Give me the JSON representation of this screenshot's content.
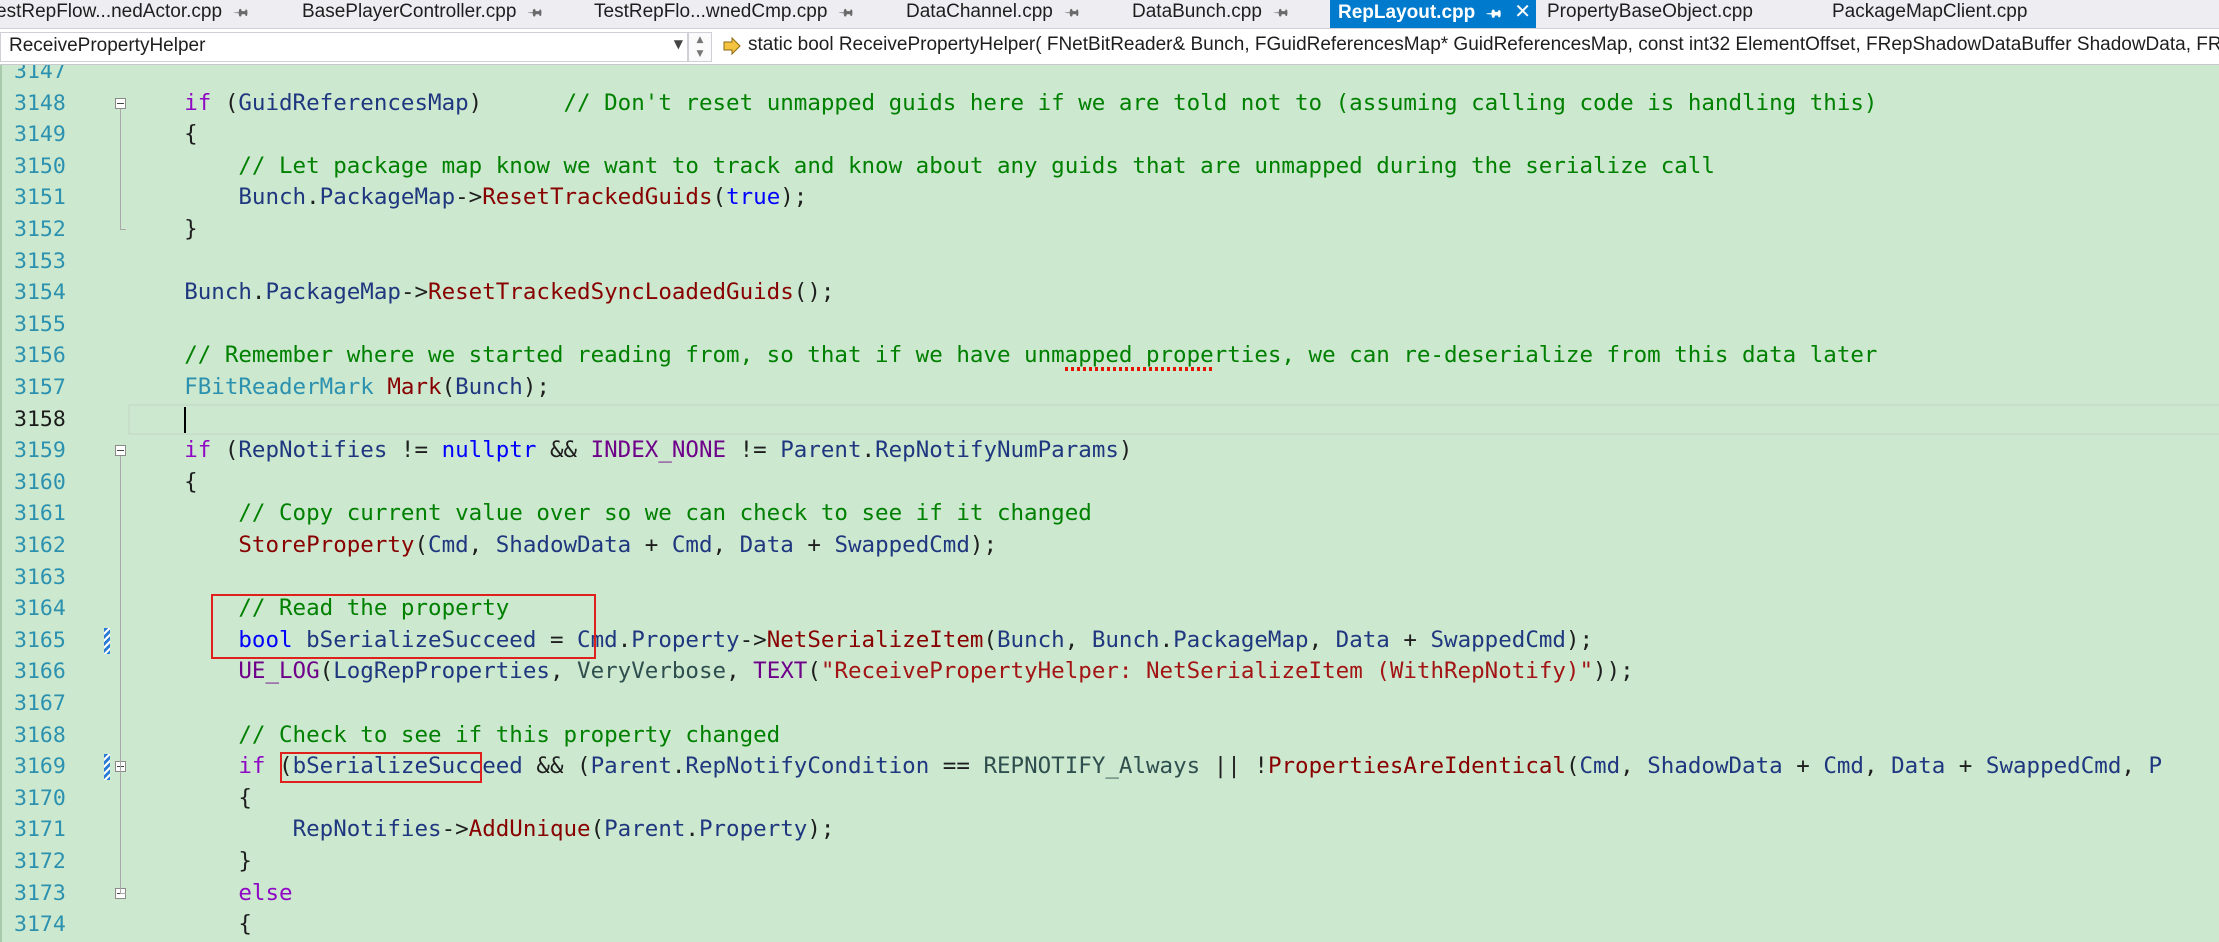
{
  "tabs": [
    {
      "label": "estRepFlow...nedActor.cpp",
      "active": false
    },
    {
      "label": "BasePlayerController.cpp",
      "active": false
    },
    {
      "label": "TestRepFlo...wnedCmp.cpp",
      "active": false
    },
    {
      "label": "DataChannel.cpp",
      "active": false
    },
    {
      "label": "DataBunch.cpp",
      "active": false
    },
    {
      "label": "RepLayout.cpp",
      "active": true
    },
    {
      "label": "PropertyBaseObject.cpp",
      "active": false
    },
    {
      "label": "PackageMapClient.cpp",
      "active": false
    }
  ],
  "navbar": {
    "scope": "ReceivePropertyHelper",
    "member": "static bool ReceivePropertyHelper( FNetBitReader& Bunch, FGuidReferencesMap* GuidReferencesMap, const int32 ElementOffset, FRepShadowDataBuffer ShadowData, FR"
  },
  "editor": {
    "current_line": "3158",
    "lines": [
      {
        "num": "3147",
        "tokens": [
          {
            "t": "        ",
            "c": "op"
          }
        ]
      },
      {
        "num": "3148",
        "tokens": [
          {
            "t": "    ",
            "c": "op"
          },
          {
            "t": "if",
            "c": "kw2"
          },
          {
            "t": " (",
            "c": "op"
          },
          {
            "t": "GuidReferencesMap",
            "c": "var"
          },
          {
            "t": ")      ",
            "c": "op"
          },
          {
            "t": "// Don't reset unmapped guids here if we are told not to (assuming calling code is handling this)",
            "c": "cm"
          }
        ]
      },
      {
        "num": "3149",
        "tokens": [
          {
            "t": "    {",
            "c": "op"
          }
        ]
      },
      {
        "num": "3150",
        "tokens": [
          {
            "t": "        ",
            "c": "op"
          },
          {
            "t": "// Let package map know we want to track and know about any guids that are unmapped during the serialize call",
            "c": "cm"
          }
        ]
      },
      {
        "num": "3151",
        "tokens": [
          {
            "t": "        ",
            "c": "op"
          },
          {
            "t": "Bunch",
            "c": "var"
          },
          {
            "t": ".",
            "c": "op"
          },
          {
            "t": "PackageMap",
            "c": "var"
          },
          {
            "t": "->",
            "c": "op"
          },
          {
            "t": "ResetTrackedGuids",
            "c": "fn"
          },
          {
            "t": "(",
            "c": "op"
          },
          {
            "t": "true",
            "c": "kw"
          },
          {
            "t": ");",
            "c": "op"
          }
        ]
      },
      {
        "num": "3152",
        "tokens": [
          {
            "t": "    }",
            "c": "op"
          }
        ]
      },
      {
        "num": "3153",
        "tokens": []
      },
      {
        "num": "3154",
        "tokens": [
          {
            "t": "    ",
            "c": "op"
          },
          {
            "t": "Bunch",
            "c": "var"
          },
          {
            "t": ".",
            "c": "op"
          },
          {
            "t": "PackageMap",
            "c": "var"
          },
          {
            "t": "->",
            "c": "op"
          },
          {
            "t": "ResetTrackedSyncLoadedGuids",
            "c": "fn"
          },
          {
            "t": "();",
            "c": "op"
          }
        ]
      },
      {
        "num": "3155",
        "tokens": []
      },
      {
        "num": "3156",
        "tokens": [
          {
            "t": "    ",
            "c": "op"
          },
          {
            "t": "// Remember where we started reading from, so that if we have unmapped properties, we can re-deserialize from this data later",
            "c": "cm"
          }
        ]
      },
      {
        "num": "3157",
        "tokens": [
          {
            "t": "    ",
            "c": "op"
          },
          {
            "t": "FBitReaderMark",
            "c": "ty"
          },
          {
            "t": " ",
            "c": "op"
          },
          {
            "t": "Mark",
            "c": "fn"
          },
          {
            "t": "(",
            "c": "op"
          },
          {
            "t": "Bunch",
            "c": "var"
          },
          {
            "t": ");",
            "c": "op"
          }
        ]
      },
      {
        "num": "3158",
        "tokens": []
      },
      {
        "num": "3159",
        "tokens": [
          {
            "t": "    ",
            "c": "op"
          },
          {
            "t": "if",
            "c": "kw2"
          },
          {
            "t": " (",
            "c": "op"
          },
          {
            "t": "RepNotifies",
            "c": "var"
          },
          {
            "t": " != ",
            "c": "op"
          },
          {
            "t": "nullptr",
            "c": "kw"
          },
          {
            "t": " && ",
            "c": "op"
          },
          {
            "t": "INDEX_NONE",
            "c": "mac"
          },
          {
            "t": " != ",
            "c": "op"
          },
          {
            "t": "Parent",
            "c": "var"
          },
          {
            "t": ".",
            "c": "op"
          },
          {
            "t": "RepNotifyNumParams",
            "c": "var"
          },
          {
            "t": ")",
            "c": "op"
          }
        ]
      },
      {
        "num": "3160",
        "tokens": [
          {
            "t": "    {",
            "c": "op"
          }
        ]
      },
      {
        "num": "3161",
        "tokens": [
          {
            "t": "        ",
            "c": "op"
          },
          {
            "t": "// Copy current value over so we can check to see if it changed",
            "c": "cm"
          }
        ]
      },
      {
        "num": "3162",
        "tokens": [
          {
            "t": "        ",
            "c": "op"
          },
          {
            "t": "StoreProperty",
            "c": "fn"
          },
          {
            "t": "(",
            "c": "op"
          },
          {
            "t": "Cmd",
            "c": "var"
          },
          {
            "t": ", ",
            "c": "op"
          },
          {
            "t": "ShadowData",
            "c": "var"
          },
          {
            "t": " + ",
            "c": "op"
          },
          {
            "t": "Cmd",
            "c": "var"
          },
          {
            "t": ", ",
            "c": "op"
          },
          {
            "t": "Data",
            "c": "var"
          },
          {
            "t": " + ",
            "c": "op"
          },
          {
            "t": "SwappedCmd",
            "c": "var"
          },
          {
            "t": ");",
            "c": "op"
          }
        ]
      },
      {
        "num": "3163",
        "tokens": []
      },
      {
        "num": "3164",
        "tokens": [
          {
            "t": "        ",
            "c": "op"
          },
          {
            "t": "// Read the property",
            "c": "cm"
          }
        ]
      },
      {
        "num": "3165",
        "tokens": [
          {
            "t": "        ",
            "c": "op"
          },
          {
            "t": "bool",
            "c": "kw"
          },
          {
            "t": " ",
            "c": "op"
          },
          {
            "t": "bSerializeSucceed",
            "c": "var"
          },
          {
            "t": " = ",
            "c": "op"
          },
          {
            "t": "Cmd",
            "c": "var"
          },
          {
            "t": ".",
            "c": "op"
          },
          {
            "t": "Property",
            "c": "var"
          },
          {
            "t": "->",
            "c": "op"
          },
          {
            "t": "NetSerializeItem",
            "c": "fn"
          },
          {
            "t": "(",
            "c": "op"
          },
          {
            "t": "Bunch",
            "c": "var"
          },
          {
            "t": ", ",
            "c": "op"
          },
          {
            "t": "Bunch",
            "c": "var"
          },
          {
            "t": ".",
            "c": "op"
          },
          {
            "t": "PackageMap",
            "c": "var"
          },
          {
            "t": ", ",
            "c": "op"
          },
          {
            "t": "Data",
            "c": "var"
          },
          {
            "t": " + ",
            "c": "op"
          },
          {
            "t": "SwappedCmd",
            "c": "var"
          },
          {
            "t": ");",
            "c": "op"
          }
        ]
      },
      {
        "num": "3166",
        "tokens": [
          {
            "t": "        ",
            "c": "op"
          },
          {
            "t": "UE_LOG",
            "c": "mac"
          },
          {
            "t": "(",
            "c": "op"
          },
          {
            "t": "LogRepProperties",
            "c": "var"
          },
          {
            "t": ", ",
            "c": "op"
          },
          {
            "t": "VeryVerbose",
            "c": "en"
          },
          {
            "t": ", ",
            "c": "op"
          },
          {
            "t": "TEXT",
            "c": "mac"
          },
          {
            "t": "(",
            "c": "op"
          },
          {
            "t": "\"ReceivePropertyHelper: NetSerializeItem (WithRepNotify)\"",
            "c": "str"
          },
          {
            "t": "));",
            "c": "op"
          }
        ]
      },
      {
        "num": "3167",
        "tokens": []
      },
      {
        "num": "3168",
        "tokens": [
          {
            "t": "        ",
            "c": "op"
          },
          {
            "t": "// Check to see if this property changed",
            "c": "cm"
          }
        ]
      },
      {
        "num": "3169",
        "tokens": [
          {
            "t": "        ",
            "c": "op"
          },
          {
            "t": "if",
            "c": "kw2"
          },
          {
            "t": " (",
            "c": "op"
          },
          {
            "t": "bSerializeSucceed",
            "c": "var"
          },
          {
            "t": " && (",
            "c": "op"
          },
          {
            "t": "Parent",
            "c": "var"
          },
          {
            "t": ".",
            "c": "op"
          },
          {
            "t": "RepNotifyCondition",
            "c": "var"
          },
          {
            "t": " == ",
            "c": "op"
          },
          {
            "t": "REPNOTIFY_Always",
            "c": "en"
          },
          {
            "t": " || !",
            "c": "op"
          },
          {
            "t": "PropertiesAreIdentical",
            "c": "fn"
          },
          {
            "t": "(",
            "c": "op"
          },
          {
            "t": "Cmd",
            "c": "var"
          },
          {
            "t": ", ",
            "c": "op"
          },
          {
            "t": "ShadowData",
            "c": "var"
          },
          {
            "t": " + ",
            "c": "op"
          },
          {
            "t": "Cmd",
            "c": "var"
          },
          {
            "t": ", ",
            "c": "op"
          },
          {
            "t": "Data",
            "c": "var"
          },
          {
            "t": " + ",
            "c": "op"
          },
          {
            "t": "SwappedCmd",
            "c": "var"
          },
          {
            "t": ", ",
            "c": "op"
          },
          {
            "t": "P",
            "c": "var"
          }
        ]
      },
      {
        "num": "3170",
        "tokens": [
          {
            "t": "        {",
            "c": "op"
          }
        ]
      },
      {
        "num": "3171",
        "tokens": [
          {
            "t": "            ",
            "c": "op"
          },
          {
            "t": "RepNotifies",
            "c": "var"
          },
          {
            "t": "->",
            "c": "op"
          },
          {
            "t": "AddUnique",
            "c": "fn"
          },
          {
            "t": "(",
            "c": "op"
          },
          {
            "t": "Parent",
            "c": "var"
          },
          {
            "t": ".",
            "c": "op"
          },
          {
            "t": "Property",
            "c": "var"
          },
          {
            "t": ");",
            "c": "op"
          }
        ]
      },
      {
        "num": "3172",
        "tokens": [
          {
            "t": "        }",
            "c": "op"
          }
        ]
      },
      {
        "num": "3173",
        "tokens": [
          {
            "t": "        ",
            "c": "op"
          },
          {
            "t": "else",
            "c": "kw2"
          }
        ]
      },
      {
        "num": "3174",
        "tokens": [
          {
            "t": "        {",
            "c": "op"
          }
        ]
      }
    ]
  }
}
